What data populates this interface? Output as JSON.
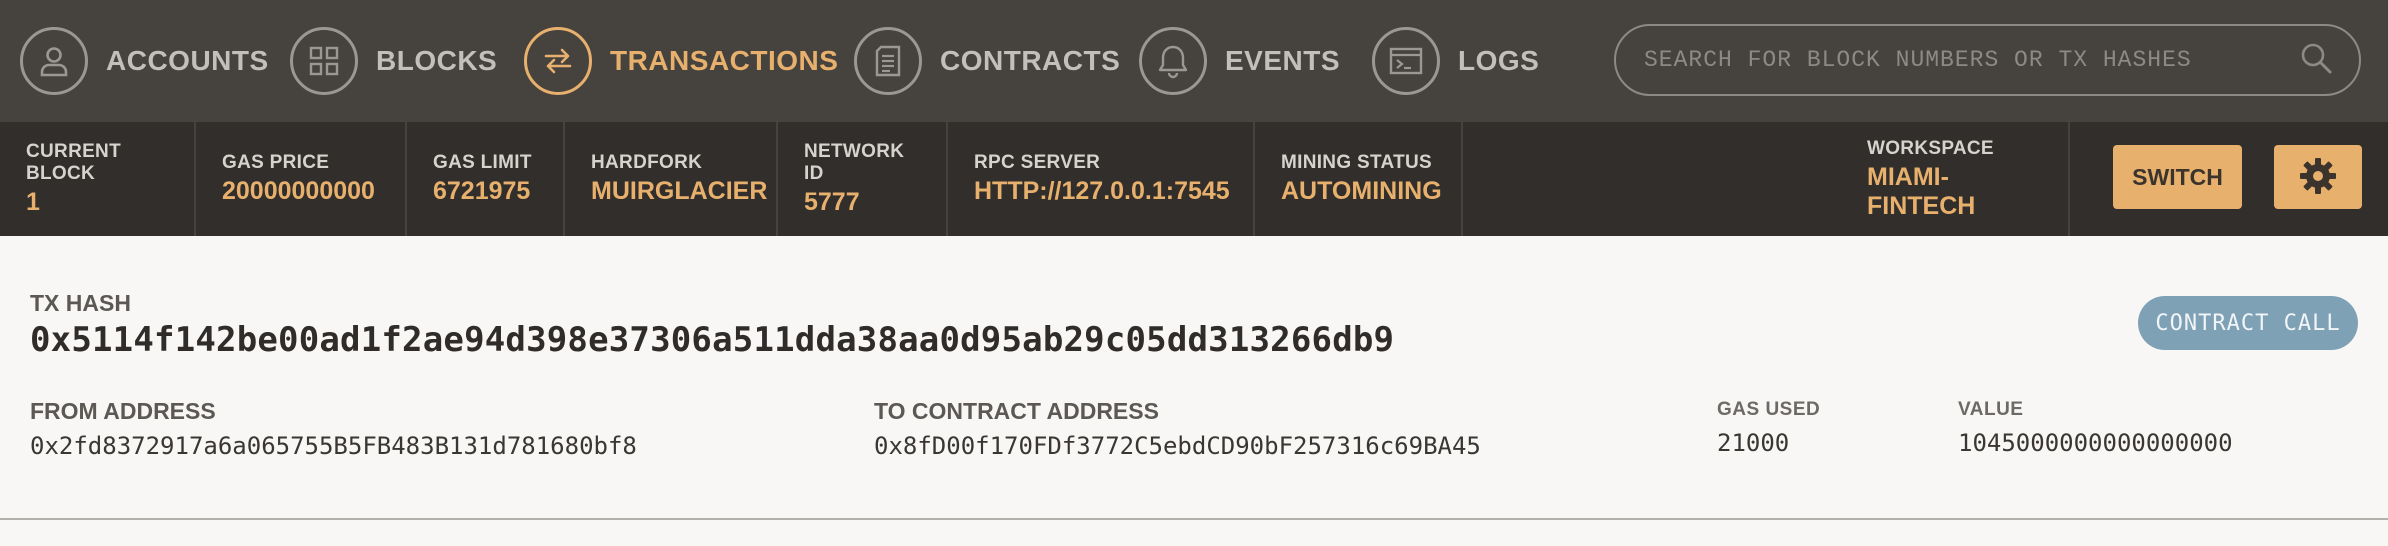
{
  "nav": {
    "items": [
      {
        "label": "ACCOUNTS",
        "icon": "user-icon"
      },
      {
        "label": "BLOCKS",
        "icon": "grid-icon"
      },
      {
        "label": "TRANSACTIONS",
        "icon": "swap-icon",
        "active": true
      },
      {
        "label": "CONTRACTS",
        "icon": "document-icon"
      },
      {
        "label": "EVENTS",
        "icon": "bell-icon"
      },
      {
        "label": "LOGS",
        "icon": "terminal-icon"
      }
    ],
    "search_placeholder": "SEARCH FOR BLOCK NUMBERS OR TX HASHES"
  },
  "status": {
    "current_block": {
      "label": "CURRENT BLOCK",
      "value": "1"
    },
    "gas_price": {
      "label": "GAS PRICE",
      "value": "20000000000"
    },
    "gas_limit": {
      "label": "GAS LIMIT",
      "value": "6721975"
    },
    "hardfork": {
      "label": "HARDFORK",
      "value": "MUIRGLACIER"
    },
    "network_id": {
      "label": "NETWORK ID",
      "value": "5777"
    },
    "rpc_server": {
      "label": "RPC SERVER",
      "value": "HTTP://127.0.0.1:7545"
    },
    "mining_status": {
      "label": "MINING STATUS",
      "value": "AUTOMINING"
    },
    "workspace": {
      "label": "WORKSPACE",
      "value": "MIAMI-FINTECH"
    },
    "switch_label": "SWITCH"
  },
  "tx": {
    "hash_label": "TX HASH",
    "hash": "0x5114f142be00ad1f2ae94d398e37306a511dda38aa0d95ab29c05dd313266db9",
    "type_badge": "CONTRACT CALL",
    "from_label": "FROM ADDRESS",
    "from": "0x2fd8372917a6a065755B5FB483B131d781680bf8",
    "to_label": "TO CONTRACT ADDRESS",
    "to": "0x8fD00f170FDf3772C5ebdCD90bF257316c69BA45",
    "gas_used_label": "GAS USED",
    "gas_used": "21000",
    "value_label": "VALUE",
    "value": "1045000000000000000"
  },
  "colors": {
    "accent": "#e8b06d",
    "nav_bg": "#46433f",
    "status_bg": "#312e2b",
    "badge": "#7ea1b6"
  }
}
